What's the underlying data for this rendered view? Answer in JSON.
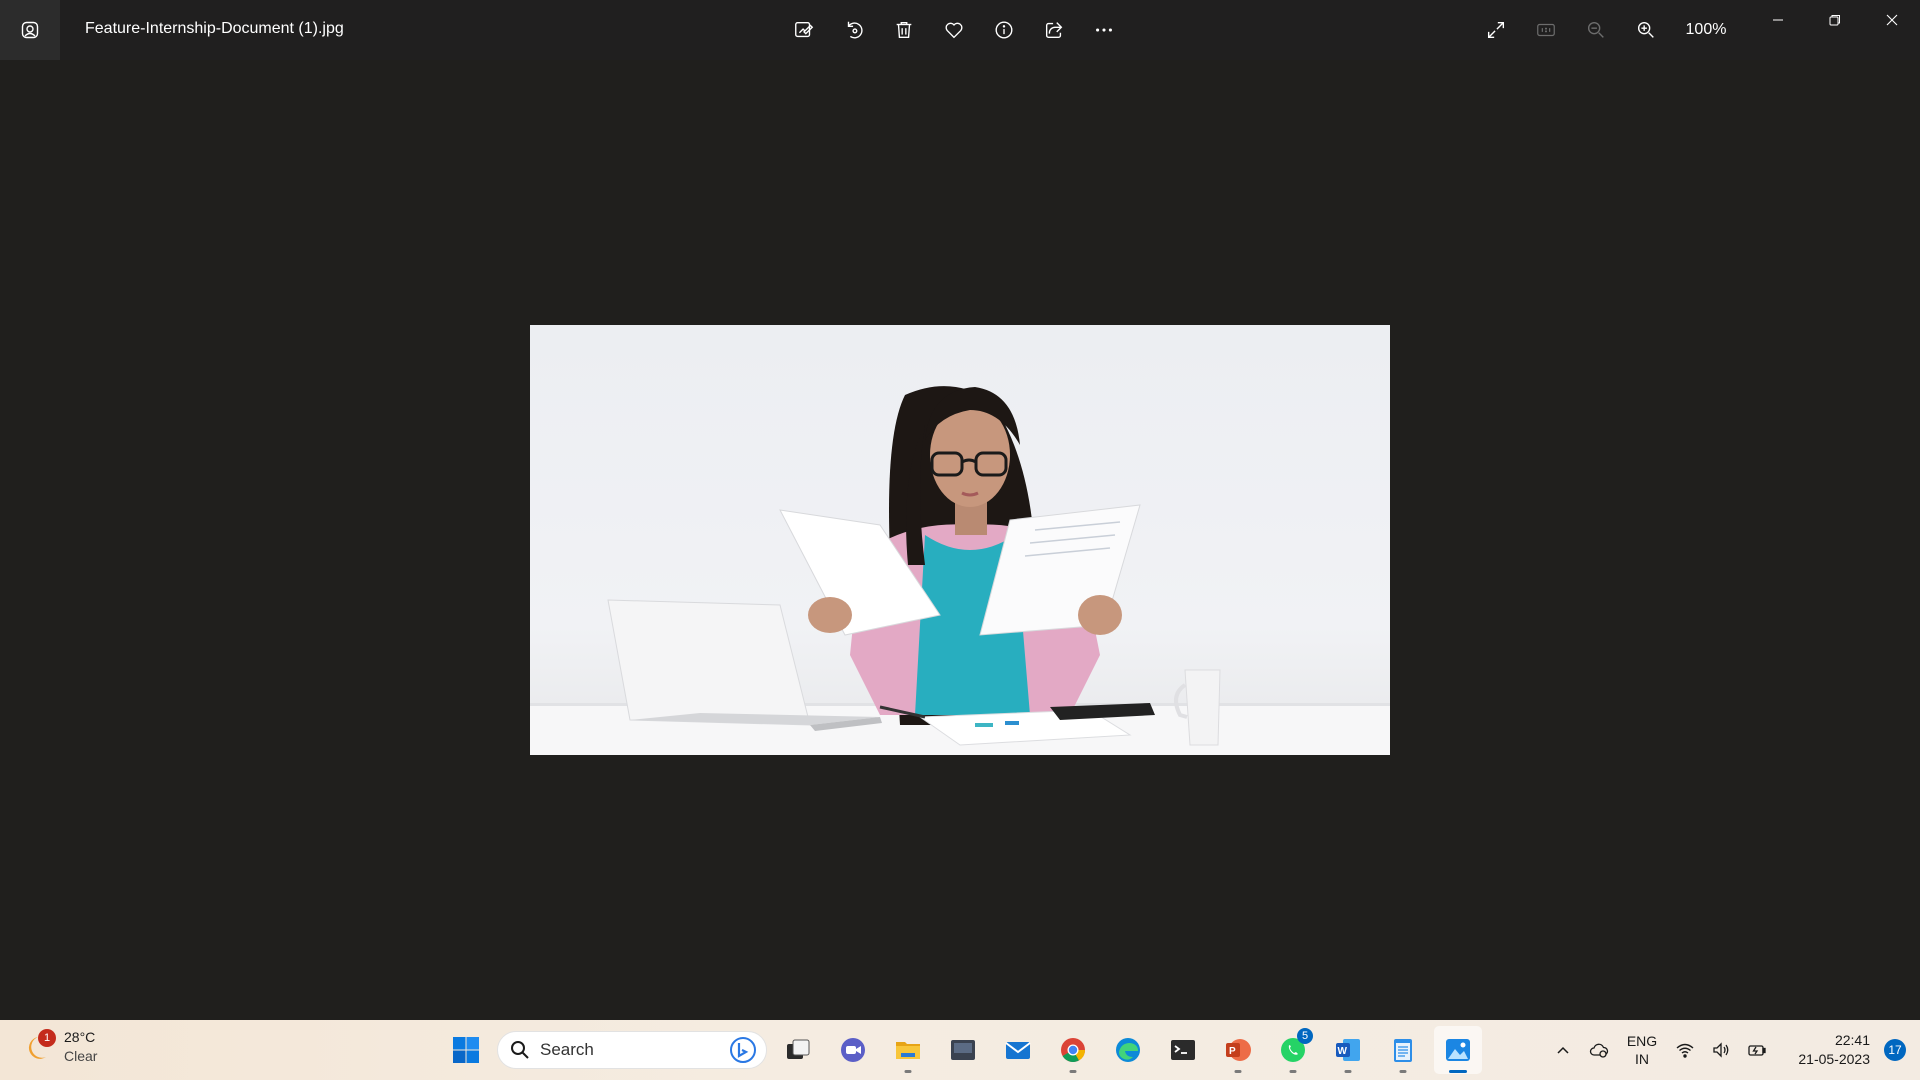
{
  "window": {
    "file_name": "Feature-Internship-Document (1).jpg",
    "zoom_level": "100%"
  },
  "toolbar": {
    "actions": [
      "edit-image",
      "rotate",
      "delete",
      "favorite",
      "file-info",
      "share",
      "more-options"
    ]
  },
  "view_controls": [
    "full-screen",
    "actual-size",
    "zoom-out",
    "zoom-in"
  ],
  "taskbar": {
    "weather": {
      "temperature": "28°C",
      "condition": "Clear",
      "alert_count": "1"
    },
    "search_placeholder": "Search",
    "whatsapp_badge": "5",
    "language": {
      "line1": "ENG",
      "line2": "IN"
    },
    "clock": {
      "time": "22:41",
      "date": "21-05-2023"
    },
    "notification_count": "17"
  },
  "colors": {
    "background": "#201f1d",
    "accent": "#0067c0",
    "taskbar": "#f4e9dc"
  }
}
